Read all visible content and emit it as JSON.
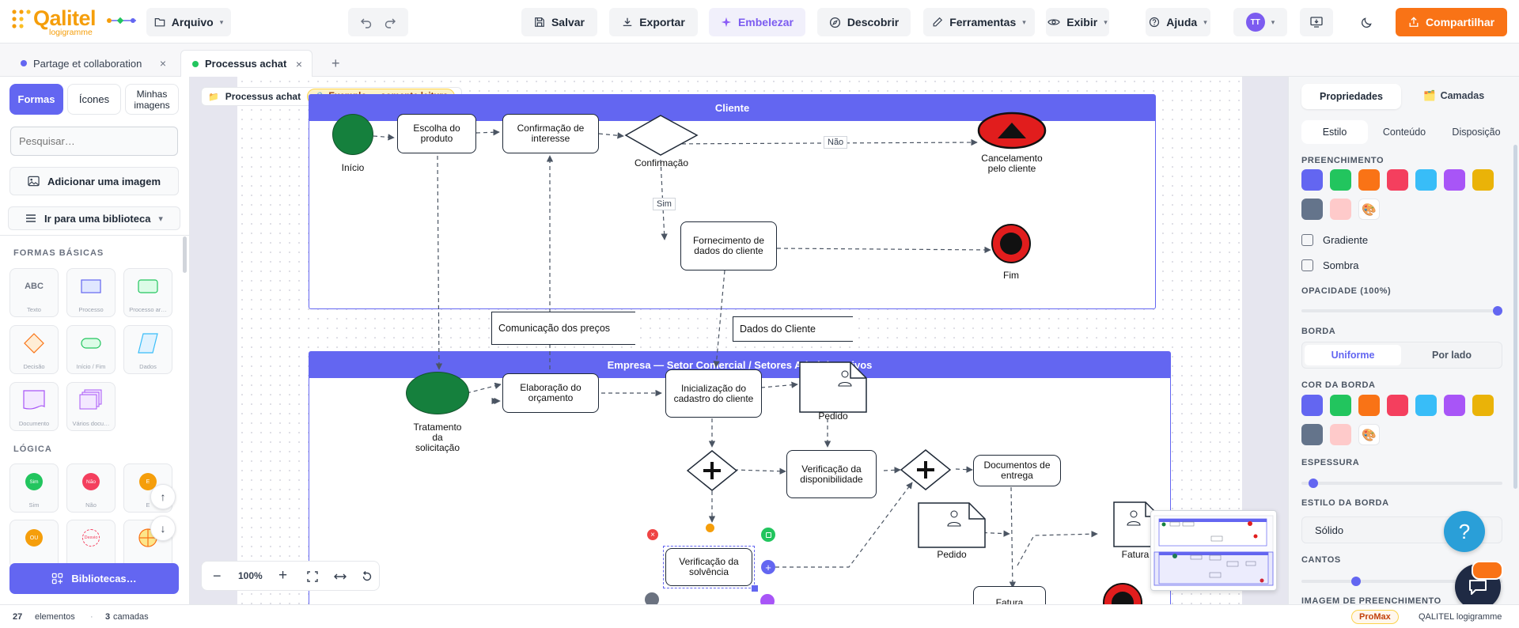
{
  "app": {
    "name": "Qalitel",
    "sub": "logigramme"
  },
  "toolbar": {
    "arquivo": "Arquivo",
    "salvar": "Salvar",
    "exportar": "Exportar",
    "embelezar": "Embelezar",
    "descobrir": "Descobrir",
    "ferramentas": "Ferramentas",
    "exibir": "Exibir",
    "ajuda": "Ajuda",
    "avatar": "TT",
    "compartilhar": "Compartilhar"
  },
  "tabs": [
    {
      "label": "Partage et collaboration",
      "color": "#6366f1"
    },
    {
      "label": "Processus achat",
      "color": "#22c55e"
    }
  ],
  "left": {
    "tabs": [
      "Formas",
      "Ícones",
      "Minhas imagens"
    ],
    "search_placeholder": "Pesquisar…",
    "add_image": "Adicionar uma imagem",
    "library": "Ir para uma biblioteca",
    "section_basic": "FORMAS BÁSICAS",
    "basic": [
      "Texto",
      "Processo",
      "Processo ar…",
      "Decisão",
      "Início / Fim",
      "Dados",
      "Documento",
      "Vários docu…"
    ],
    "abc": "ABC",
    "section_logic": "LÓGICA",
    "logic": [
      "Sim",
      "Não",
      "E",
      "OU",
      "Desvio",
      ""
    ],
    "logic_badges": [
      "Sim",
      "Não",
      "E",
      "OU",
      "Desvio"
    ],
    "libraries_button": "Bibliotecas…"
  },
  "canvas": {
    "breadcrumb": "Processus achat",
    "readonly": "Exemplo — somente leitura",
    "pool1": "Cliente",
    "pool2": "Empresa — Setor Comercial / Setores Administrativos",
    "nodes": {
      "inicio": "Início",
      "escolha": "Escolha do produto",
      "confirmacao_interesse": "Confirmação de interesse",
      "confirmacao": "Confirmação",
      "cancelamento": "Cancelamento pelo cliente",
      "fornecimento": "Fornecimento de dados do cliente",
      "fim": "Fim",
      "comunicacao": "Comunicação dos preços",
      "dados_cliente": "Dados do Cliente",
      "tratamento": "Tratamento da solicitação",
      "elaboracao": "Elaboração do orçamento",
      "inicializacao": "Inicialização do cadastro do cliente",
      "pedido1": "Pedido",
      "verif_disp": "Verificação da disponibilidade",
      "documentos": "Documentos de entrega",
      "pedido2": "Pedido",
      "fatura1": "Fatura",
      "fatura2": "Fatura",
      "verif_solv": "Verificação da solvência"
    },
    "edge_nao": "Não",
    "edge_sim": "Sim",
    "zoom": "100%"
  },
  "right": {
    "tabs": [
      "Propriedades",
      "Camadas"
    ],
    "subtabs": [
      "Estilo",
      "Conteúdo",
      "Disposição"
    ],
    "fill_label": "PREENCHIMENTO",
    "palette": [
      "#6366f1",
      "#22c55e",
      "#f97316",
      "#f43f5e",
      "#38bdf8",
      "#a855f7",
      "#eab308",
      "#64748b",
      "#fecaca"
    ],
    "gradient": "Gradiente",
    "shadow": "Sombra",
    "opacity_label": "OPACIDADE (100%)",
    "opacity": 1.0,
    "border_label": "BORDA",
    "border_uniform": "Uniforme",
    "border_side": "Por lado",
    "border_color_label": "COR DA BORDA",
    "thickness_label": "ESPESSURA",
    "thickness": 0.06,
    "border_style_label": "ESTILO DA BORDA",
    "border_style": "Sólido",
    "corners_label": "CANTOS",
    "corners": 0.27,
    "fill_image_label": "IMAGEM DE PREENCHIMENTO"
  },
  "status": {
    "elements": "27",
    "elements_label": "elementos",
    "layers": "3",
    "layers_label": "camadas",
    "badge": "ProMax",
    "product": "QALITEL logigramme"
  }
}
